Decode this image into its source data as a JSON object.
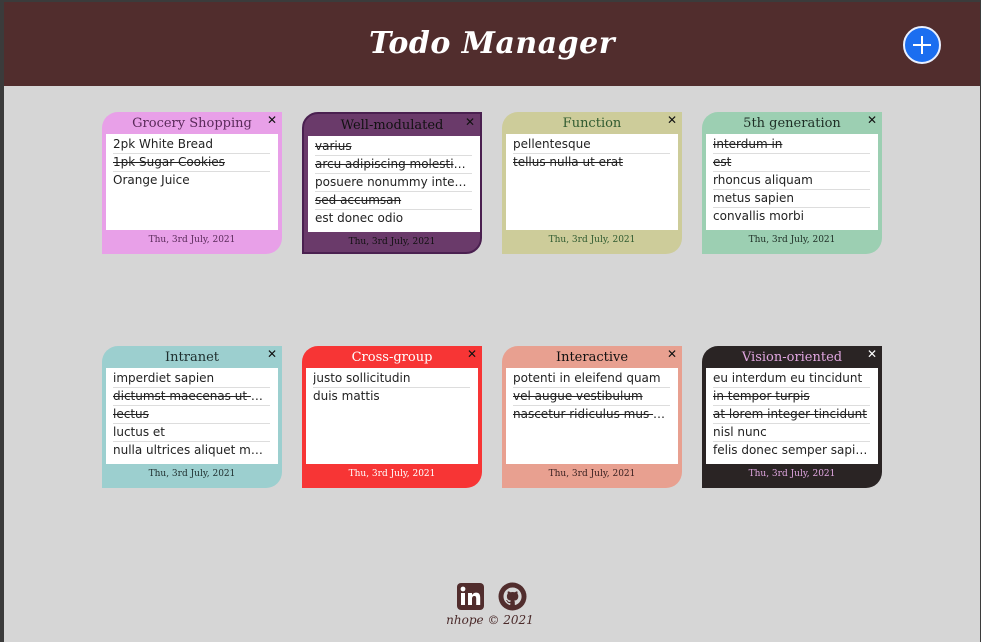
{
  "header": {
    "title": "Todo Manager",
    "add_label": "+"
  },
  "cards": [
    {
      "title": "Grocery Shopping",
      "date": "Thu, 3rd July, 2021",
      "bg": "#e8a0e8",
      "title_color": "#5a2a5a",
      "date_color": "#5a2a5a",
      "items": [
        {
          "text": "2pk White Bread",
          "done": false
        },
        {
          "text": "1pk Sugar Cookies",
          "done": true
        },
        {
          "text": "Orange Juice",
          "done": false
        }
      ]
    },
    {
      "title": "Well-modulated",
      "date": "Thu, 3rd July, 2021",
      "bg": "#6a3a6a",
      "title_color": "#111111",
      "date_color": "#111111",
      "items": [
        {
          "text": "varius",
          "done": true
        },
        {
          "text": "arcu adipiscing molestie he...",
          "done": true
        },
        {
          "text": "posuere nonummy integer",
          "done": false
        },
        {
          "text": "sed accumsan",
          "done": true
        },
        {
          "text": "est donec odio",
          "done": false
        }
      ]
    },
    {
      "title": "Function",
      "date": "Thu, 3rd July, 2021",
      "bg": "#cdcc9a",
      "title_color": "#2f5a2f",
      "date_color": "#2f5a2f",
      "items": [
        {
          "text": "pellentesque",
          "done": false
        },
        {
          "text": "tellus nulla ut erat",
          "done": true
        }
      ]
    },
    {
      "title": "5th generation",
      "date": "Thu, 3rd July, 2021",
      "bg": "#9ccfb2",
      "title_color": "#1e2e25",
      "date_color": "#1e2e25",
      "items": [
        {
          "text": "interdum in",
          "done": true
        },
        {
          "text": "est",
          "done": true
        },
        {
          "text": "rhoncus aliquam",
          "done": false
        },
        {
          "text": "metus sapien",
          "done": false
        },
        {
          "text": "convallis morbi",
          "done": false
        }
      ]
    },
    {
      "title": "Intranet",
      "date": "Thu, 3rd July, 2021",
      "bg": "#9ccfcf",
      "title_color": "#1e2e2e",
      "date_color": "#1e2e2e",
      "items": [
        {
          "text": "imperdiet sapien",
          "done": false
        },
        {
          "text": "dictumst maecenas ut massa",
          "done": true
        },
        {
          "text": "lectus",
          "done": true
        },
        {
          "text": "luctus et",
          "done": false
        },
        {
          "text": "nulla ultrices aliquet maece...",
          "done": false
        }
      ]
    },
    {
      "title": "Cross-group",
      "date": "Thu, 3rd July, 2021",
      "bg": "#f73535",
      "title_color": "#ffffff",
      "date_color": "#ffffff",
      "items": [
        {
          "text": "justo sollicitudin",
          "done": false
        },
        {
          "text": "duis mattis",
          "done": false
        }
      ]
    },
    {
      "title": "Interactive",
      "date": "Thu, 3rd July, 2021",
      "bg": "#e8a090",
      "title_color": "#111111",
      "date_color": "#3a2020",
      "items": [
        {
          "text": "potenti in eleifend quam",
          "done": false
        },
        {
          "text": "vel augue vestibulum",
          "done": true
        },
        {
          "text": "nascetur ridiculus mus etiam",
          "done": true
        }
      ]
    },
    {
      "title": "Vision-oriented",
      "date": "Thu, 3rd July, 2021",
      "bg": "#2a2424",
      "title_color": "#e0a6e0",
      "date_color": "#e0a6e0",
      "items": [
        {
          "text": "eu interdum eu tincidunt",
          "done": false
        },
        {
          "text": "in tempor turpis",
          "done": true
        },
        {
          "text": "at lorem integer tincidunt",
          "done": true
        },
        {
          "text": "nisl nunc",
          "done": false
        },
        {
          "text": "felis donec semper sapien",
          "done": false
        }
      ]
    }
  ],
  "footer": {
    "linkedin_icon": "linkedin-icon",
    "github_icon": "github-icon",
    "copyright": "nhope © 2021"
  }
}
